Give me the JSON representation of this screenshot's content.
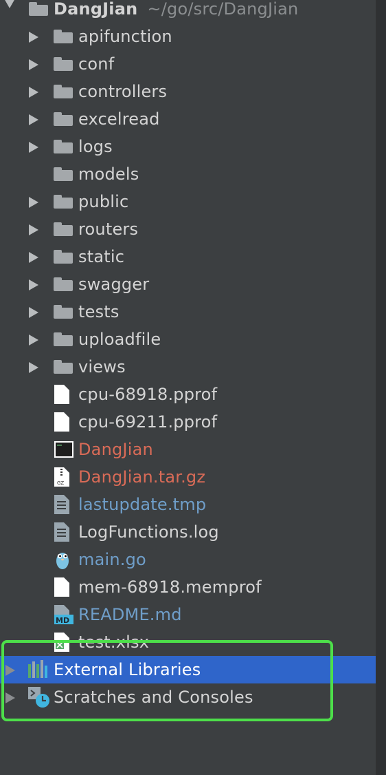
{
  "project": {
    "name": "DangJian",
    "path": "~/go/src/DangJian"
  },
  "tree_items": [
    {
      "label": "apifunction",
      "kind": "folder",
      "expandable": true,
      "color": "default"
    },
    {
      "label": "conf",
      "kind": "folder",
      "expandable": true,
      "color": "default"
    },
    {
      "label": "controllers",
      "kind": "folder",
      "expandable": true,
      "color": "default"
    },
    {
      "label": "excelread",
      "kind": "folder",
      "expandable": true,
      "color": "default"
    },
    {
      "label": "logs",
      "kind": "folder",
      "expandable": true,
      "color": "default"
    },
    {
      "label": "models",
      "kind": "folder",
      "expandable": false,
      "color": "default"
    },
    {
      "label": "public",
      "kind": "folder",
      "expandable": true,
      "color": "default"
    },
    {
      "label": "routers",
      "kind": "folder",
      "expandable": true,
      "color": "default"
    },
    {
      "label": "static",
      "kind": "folder",
      "expandable": true,
      "color": "default"
    },
    {
      "label": "swagger",
      "kind": "folder",
      "expandable": true,
      "color": "default"
    },
    {
      "label": "tests",
      "kind": "folder",
      "expandable": true,
      "color": "default"
    },
    {
      "label": "uploadfile",
      "kind": "folder",
      "expandable": true,
      "color": "default"
    },
    {
      "label": "views",
      "kind": "folder",
      "expandable": true,
      "color": "default"
    },
    {
      "label": "cpu-68918.pprof",
      "kind": "file-blank",
      "color": "default"
    },
    {
      "label": "cpu-69211.pprof",
      "kind": "file-blank",
      "color": "default"
    },
    {
      "label": "DangJian",
      "kind": "file-executable",
      "color": "#d96b57"
    },
    {
      "label": "DangJian.tar.gz",
      "kind": "file-archive",
      "color": "#d96b57"
    },
    {
      "label": "lastupdate.tmp",
      "kind": "file-text",
      "color": "#6f9ec9"
    },
    {
      "label": "LogFunctions.log",
      "kind": "file-text",
      "color": "default"
    },
    {
      "label": "main.go",
      "kind": "file-go",
      "color": "#6f9ec9"
    },
    {
      "label": "mem-68918.memprof",
      "kind": "file-blank",
      "color": "default"
    },
    {
      "label": "README.md",
      "kind": "file-markdown",
      "color": "#6f9ec9"
    },
    {
      "label": "test.xlsx",
      "kind": "file-xlsx",
      "color": "default"
    }
  ],
  "external_libraries": {
    "label": "External Libraries",
    "selected": true
  },
  "scratches": {
    "label": "Scratches and Consoles"
  },
  "colors": {
    "background": "#3c3f41",
    "selection": "#2f65ca",
    "highlight_box": "#4ddf4a",
    "vcs_modified_blue": "#6f9ec9",
    "vcs_unversioned_red": "#d96b57"
  }
}
